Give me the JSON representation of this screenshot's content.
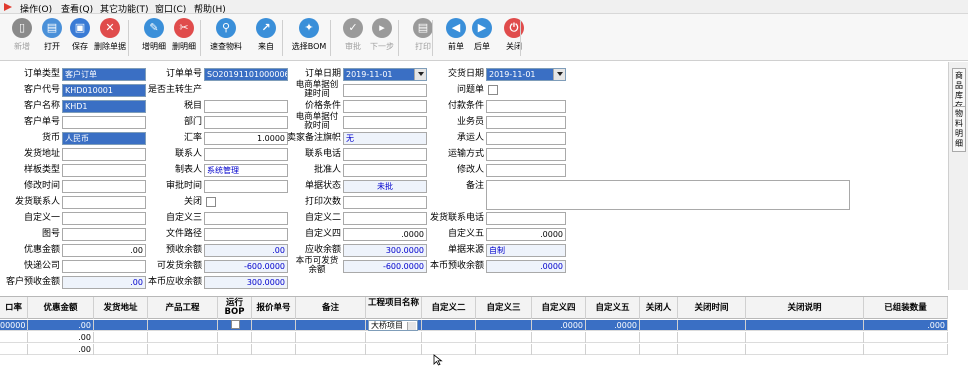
{
  "menu": [
    "操作(O)",
    "查看(Q)",
    "其它功能(T)",
    "窗口(C)",
    "帮助(H)"
  ],
  "toolbar": [
    {
      "label": "新增",
      "icon": "new-doc-icon",
      "color": "#8a8a8a",
      "glyph": "▯",
      "enabled": false
    },
    {
      "label": "打开",
      "icon": "open-icon",
      "color": "#4a90d9",
      "glyph": "▤",
      "enabled": true
    },
    {
      "label": "保存",
      "icon": "save-icon",
      "color": "#3a7bd5",
      "glyph": "▣",
      "enabled": true
    },
    {
      "label": "删除单据",
      "icon": "delete-icon",
      "color": "#e04c4c",
      "glyph": "✕",
      "enabled": true
    },
    {
      "label": "增明细",
      "icon": "add-detail-icon",
      "color": "#3a8fd9",
      "glyph": "✎",
      "enabled": true
    },
    {
      "label": "删明细",
      "icon": "remove-detail-icon",
      "color": "#e04c4c",
      "glyph": "✂",
      "enabled": true
    },
    {
      "label": "速查物料",
      "icon": "search-icon",
      "color": "#3a8fd9",
      "glyph": "⚲",
      "enabled": true
    },
    {
      "label": "来自",
      "icon": "import-icon",
      "color": "#3a8fd9",
      "glyph": "↗",
      "enabled": true
    },
    {
      "label": "选择BOM",
      "icon": "bom-icon",
      "color": "#3a8fd9",
      "glyph": "✦",
      "enabled": true
    },
    {
      "label": "审批",
      "icon": "approve-icon",
      "color": "#9a9a9a",
      "glyph": "✓",
      "enabled": false
    },
    {
      "label": "下一步",
      "icon": "next-step-icon",
      "color": "#9a9a9a",
      "glyph": "▸",
      "enabled": false
    },
    {
      "label": "打印",
      "icon": "print-icon",
      "color": "#9a9a9a",
      "glyph": "▤",
      "enabled": false
    },
    {
      "label": "前单",
      "icon": "prev-record-icon",
      "color": "#3a8fd9",
      "glyph": "◀",
      "enabled": true
    },
    {
      "label": "后单",
      "icon": "next-record-icon",
      "color": "#3a8fd9",
      "glyph": "▶",
      "enabled": true
    },
    {
      "label": "关闭",
      "icon": "close-icon",
      "color": "#e04c4c",
      "glyph": "⏻",
      "enabled": true
    }
  ],
  "form": {
    "order_type": {
      "label": "订单类型",
      "value": "客户订单"
    },
    "order_no": {
      "label": "订单单号",
      "value": "SO20191101000006"
    },
    "order_date": {
      "label": "订单日期",
      "value": "2019-11-01"
    },
    "delivery_date": {
      "label": "交货日期",
      "value": "2019-11-01"
    },
    "customer_code": {
      "label": "客户代号",
      "value": "KHD010001"
    },
    "convert_to_prod": {
      "label": "是否主转生产",
      "value": ""
    },
    "ecom_created": {
      "label": "电商单据创建时间",
      "value": ""
    },
    "problem_order": {
      "label": "问题单",
      "value": ""
    },
    "customer_name": {
      "label": "客户名称",
      "value": "KHD1"
    },
    "tax_category": {
      "label": "税目",
      "value": ""
    },
    "price_terms": {
      "label": "价格条件",
      "value": ""
    },
    "payment_terms": {
      "label": "付款条件",
      "value": ""
    },
    "customer_doc_no": {
      "label": "客户单号",
      "value": ""
    },
    "department": {
      "label": "部门",
      "value": ""
    },
    "ecom_paid": {
      "label": "电商单据付款时间",
      "value": ""
    },
    "salesman": {
      "label": "业务员",
      "value": ""
    },
    "currency": {
      "label": "货币",
      "value": "人民币"
    },
    "exchange_rate": {
      "label": "汇率",
      "value": "1.0000"
    },
    "seller_flag": {
      "label": "卖家备注旗帜",
      "value": "无"
    },
    "carrier": {
      "label": "承运人",
      "value": ""
    },
    "ship_address": {
      "label": "发货地址",
      "value": ""
    },
    "contact": {
      "label": "联系人",
      "value": ""
    },
    "contact_phone": {
      "label": "联系电话",
      "value": ""
    },
    "transport_mode": {
      "label": "运输方式",
      "value": ""
    },
    "sample_type": {
      "label": "样板类型",
      "value": ""
    },
    "maker": {
      "label": "制表人",
      "value": "系统管理"
    },
    "approver": {
      "label": "批准人",
      "value": ""
    },
    "modifier": {
      "label": "修改人",
      "value": ""
    },
    "modify_time": {
      "label": "修改时间",
      "value": ""
    },
    "approve_time": {
      "label": "审批时间",
      "value": ""
    },
    "doc_status": {
      "label": "单据状态",
      "value": "未批"
    },
    "remarks": {
      "label": "备注",
      "value": ""
    },
    "ship_contact": {
      "label": "发货联系人",
      "value": ""
    },
    "closed": {
      "label": "关闭",
      "value": ""
    },
    "print_count": {
      "label": "打印次数",
      "value": ""
    },
    "custom1": {
      "label": "自定义一",
      "value": ""
    },
    "custom3": {
      "label": "自定义三",
      "value": ""
    },
    "custom2": {
      "label": "自定义二",
      "value": ""
    },
    "ship_contact_phone": {
      "label": "发货联系电话",
      "value": ""
    },
    "drawing_no": {
      "label": "图号",
      "value": ""
    },
    "file_path": {
      "label": "文件路径",
      "value": ""
    },
    "custom4": {
      "label": "自定义四",
      "value": ".0000"
    },
    "custom5": {
      "label": "自定义五",
      "value": ".0000"
    },
    "discount_amount": {
      "label": "优惠金额",
      "value": ".00"
    },
    "prepaid_balance": {
      "label": "预收余额",
      "value": ".00"
    },
    "receivable_balance": {
      "label": "应收余额",
      "value": "300.0000"
    },
    "doc_source": {
      "label": "单据来源",
      "value": "自制"
    },
    "express_company": {
      "label": "快递公司",
      "value": ""
    },
    "shippable_balance": {
      "label": "可发货余额",
      "value": "-600.0000"
    },
    "local_shippable_balance": {
      "label": "本币可发货余额",
      "value": "-600.0000"
    },
    "local_prepaid_balance": {
      "label": "本币预收余额",
      "value": ".0000"
    },
    "customer_prepaid_amount": {
      "label": "客户预收金额",
      "value": ".00"
    },
    "local_receivable_balance": {
      "label": "本币应收余额",
      "value": "300.0000"
    }
  },
  "side_tabs": [
    "商品库存",
    "物料明细"
  ],
  "grid": {
    "columns": [
      "ロ率",
      "优惠金额",
      "发货地址",
      "产品工程",
      "运行BOP",
      "报价单号",
      "备注",
      "工程项目名称",
      "自定义二",
      "自定义三",
      "自定义四",
      "自定义五",
      "关闭人",
      "关闭时间",
      "关闭说明",
      "已组装数量"
    ],
    "rows": [
      {
        "rate": "00000",
        "discount": ".00",
        "project": "大桥项目",
        "custom4": ".0000",
        "custom5": ".0000",
        "assembled": ".000"
      },
      {
        "rate": "",
        "discount": ".00",
        "project": "",
        "custom4": "",
        "custom5": "",
        "assembled": ""
      },
      {
        "rate": "",
        "discount": ".00",
        "project": "",
        "custom4": "",
        "custom5": "",
        "assembled": ""
      }
    ]
  },
  "colors": {
    "selected_field": "#3a6fc4",
    "accent_text": "#0000cc"
  }
}
